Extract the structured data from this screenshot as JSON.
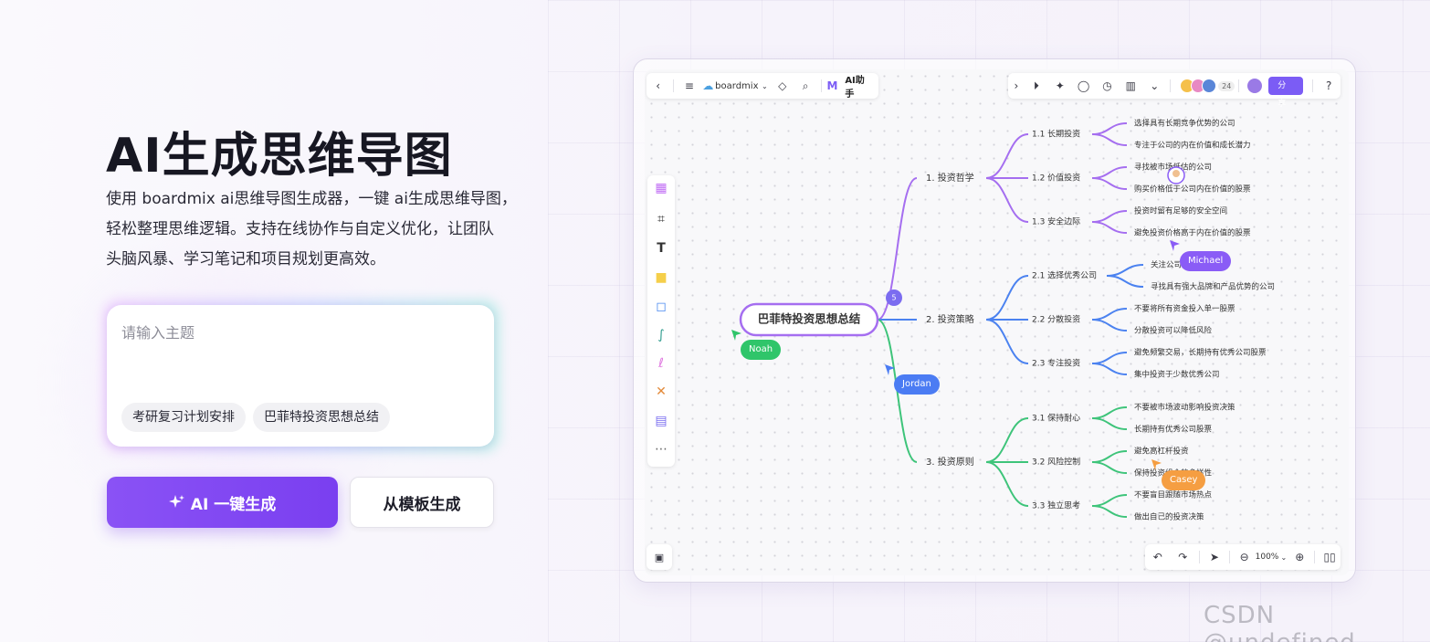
{
  "hero": {
    "title": "AI生成思维导图",
    "description_line1": "使用 boardmix ai思维导图生成器，一键 ai生成思维导图，",
    "description_line2": "轻松整理思维逻辑。支持在线协作与自定义优化，让团队",
    "description_line3": "头脑风暴、学习笔记和项目规划更高效。"
  },
  "input": {
    "placeholder": "请输入主题",
    "suggestions": [
      "考研复习计划安排",
      "巴菲特投资思想总结"
    ]
  },
  "buttons": {
    "ai_generate": "AI 一键生成",
    "template_generate": "从模板生成"
  },
  "board": {
    "app_name": "boardmix",
    "ai_assistant": "AI助手",
    "share": "分享",
    "collaborator_count": "24",
    "zoom": "100%",
    "badge_count": "5",
    "cursors": [
      "Noah",
      "Jordan",
      "Michael",
      "Casey"
    ]
  },
  "mindmap": {
    "root": "巴菲特投资思想总结",
    "branches": [
      {
        "label": "1. 投资哲学",
        "color": "#a56ef0",
        "children": [
          {
            "label": "1.1 长期投资",
            "leaves": [
              "选择具有长期竞争优势的公司",
              "专注于公司的内在价值和成长潜力"
            ]
          },
          {
            "label": "1.2 价值投资",
            "leaves": [
              "寻找被市场低估的公司",
              "购买价格低于公司内在价值的股票"
            ]
          },
          {
            "label": "1.3 安全边际",
            "leaves": [
              "投资时留有足够的安全空间",
              "避免投资价格高于内在价值的股票"
            ]
          }
        ]
      },
      {
        "label": "2. 投资策略",
        "color": "#4b82f0",
        "children": [
          {
            "label": "2.1 选择优秀公司",
            "leaves": [
              "关注公司的管理层",
              "寻找具有强大品牌和产品优势的公司"
            ]
          },
          {
            "label": "2.2 分散投资",
            "leaves": [
              "不要将所有资金投入单一股票",
              "分散投资可以降低风险"
            ]
          },
          {
            "label": "2.3 专注投资",
            "leaves": [
              "避免频繁交易，长期持有优秀公司股票",
              "集中投资于少数优秀公司"
            ]
          }
        ]
      },
      {
        "label": "3. 投资原则",
        "color": "#3ec47a",
        "children": [
          {
            "label": "3.1 保持耐心",
            "leaves": [
              "不要被市场波动影响投资决策",
              "长期持有优秀公司股票"
            ]
          },
          {
            "label": "3.2 风险控制",
            "leaves": [
              "避免高杠杆投资",
              "保持投资组合的多样性"
            ]
          },
          {
            "label": "3.3 独立思考",
            "leaves": [
              "不要盲目跟随市场热点",
              "做出自己的投资决策"
            ]
          }
        ]
      }
    ]
  },
  "colors": {
    "accent": "#7b45f2",
    "root_border": "#a56ef0",
    "noah": "#2fc56a",
    "jordan": "#4b7cf3",
    "michael": "#8a5cf6",
    "casey": "#f59e42"
  },
  "watermark": "CSDN @undefined"
}
